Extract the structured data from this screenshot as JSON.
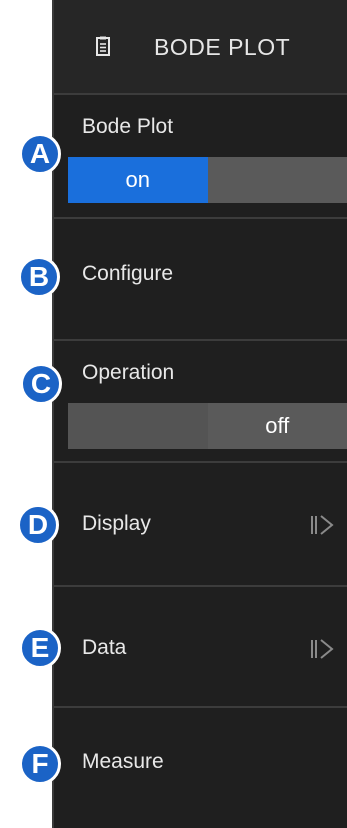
{
  "header": {
    "title": "BODE PLOT",
    "icon": "clipboard-icon"
  },
  "sections": {
    "bode_plot": {
      "label": "Bode Plot",
      "toggle": {
        "on_label": "on",
        "off_label": "",
        "state": "on"
      }
    },
    "configure": {
      "label": "Configure"
    },
    "operation": {
      "label": "Operation",
      "toggle": {
        "on_label": "",
        "off_label": "off",
        "state": "off"
      }
    },
    "display": {
      "label": "Display",
      "icon": "submenu-arrow-icon"
    },
    "data": {
      "label": "Data",
      "icon": "submenu-arrow-icon"
    },
    "measure": {
      "label": "Measure"
    }
  },
  "badges": {
    "a": "A",
    "b": "B",
    "c": "C",
    "d": "D",
    "e": "E",
    "f": "F"
  },
  "colors": {
    "accent": "#1a6fdc",
    "badge": "#1b63c6",
    "panel_bg": "#1f1f1f",
    "toggle_off": "#5a5a5a"
  }
}
